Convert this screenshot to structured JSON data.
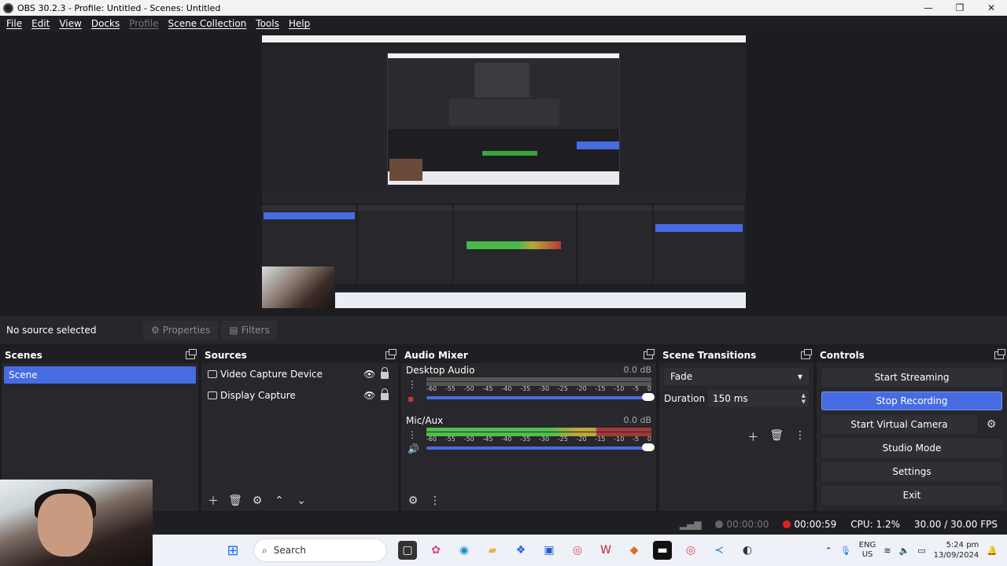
{
  "window": {
    "title": "OBS 30.2.3 - Profile: Untitled - Scenes: Untitled",
    "minimize": "—",
    "maximize": "❐",
    "close": "✕"
  },
  "menu": {
    "items": [
      "File",
      "Edit",
      "View",
      "Docks",
      "Profile",
      "Scene Collection",
      "Tools",
      "Help"
    ]
  },
  "source_bar": {
    "status": "No source selected",
    "properties": "Properties",
    "filters": "Filters"
  },
  "scenes": {
    "title": "Scenes",
    "items": [
      "Scene"
    ]
  },
  "sources": {
    "title": "Sources",
    "items": [
      {
        "label": "Video Capture Device",
        "icon": "camera-icon"
      },
      {
        "label": "Display Capture",
        "icon": "monitor-icon"
      }
    ]
  },
  "mixer": {
    "title": "Audio Mixer",
    "channels": [
      {
        "name": "Desktop Audio",
        "db": "0.0 dB",
        "level": 0
      },
      {
        "name": "Mic/Aux",
        "db": "0.0 dB",
        "level": 0.78
      }
    ],
    "ticks": [
      "-60",
      "-55",
      "-50",
      "-45",
      "-40",
      "-35",
      "-30",
      "-25",
      "-20",
      "-15",
      "-10",
      "-5",
      "0"
    ]
  },
  "transitions": {
    "title": "Scene Transitions",
    "selected": "Fade",
    "duration_label": "Duration",
    "duration_value": "150 ms"
  },
  "controls": {
    "title": "Controls",
    "start_streaming": "Start Streaming",
    "stop_recording": "Stop Recording",
    "start_virtual_camera": "Start Virtual Camera",
    "studio_mode": "Studio Mode",
    "settings": "Settings",
    "exit": "Exit"
  },
  "status": {
    "stream_time": "00:00:00",
    "rec_time": "00:00:59",
    "cpu": "CPU: 1.2%",
    "fps": "30.00 / 30.00 FPS"
  },
  "taskbar": {
    "search_placeholder": "Search",
    "lang_top": "ENG",
    "lang_bottom": "US",
    "time": "5:24 pm",
    "date": "13/09/2024"
  },
  "colors": {
    "accent": "#476be0",
    "recording": "#e02020",
    "meter_green": "#4cc04c"
  }
}
